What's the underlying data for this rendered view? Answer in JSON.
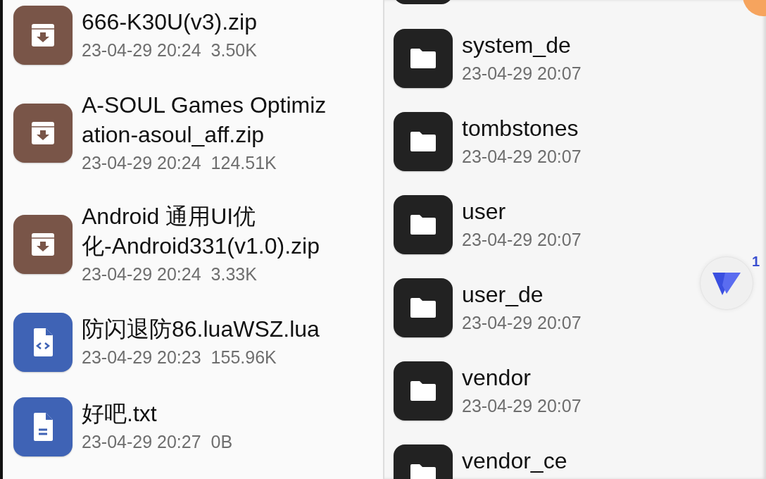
{
  "left_pane": {
    "files": [
      {
        "kind": "archive",
        "name_lines": [
          "666-K30U(v3).zip"
        ],
        "date": "23-04-29 20:24",
        "size": "3.50K"
      },
      {
        "kind": "archive",
        "name_lines": [
          "A-SOUL Games Optimiz",
          "ation-asoul_aff.zip"
        ],
        "date": "23-04-29 20:24",
        "size": "124.51K"
      },
      {
        "kind": "archive",
        "name_lines": [
          "Android 通用UI优",
          "化-Android331(v1.0).zip"
        ],
        "date": "23-04-29 20:24",
        "size": "3.33K"
      },
      {
        "kind": "code",
        "name_lines": [
          "防闪退防86.luaWSZ.lua"
        ],
        "date": "23-04-29 20:23",
        "size": "155.96K"
      },
      {
        "kind": "text",
        "name_lines": [
          "好吧.txt"
        ],
        "date": "23-04-29 20:27",
        "size": "0B"
      }
    ]
  },
  "right_pane": {
    "folders": [
      {
        "name": "system_de",
        "date": "23-04-29 20:07"
      },
      {
        "name": "tombstones",
        "date": "23-04-29 20:07"
      },
      {
        "name": "user",
        "date": "23-04-29 20:07"
      },
      {
        "name": "user_de",
        "date": "23-04-29 20:07"
      },
      {
        "name": "vendor",
        "date": "23-04-29 20:07"
      },
      {
        "name": "vendor_ce"
      }
    ]
  },
  "floating_button": {
    "badge": "1"
  }
}
